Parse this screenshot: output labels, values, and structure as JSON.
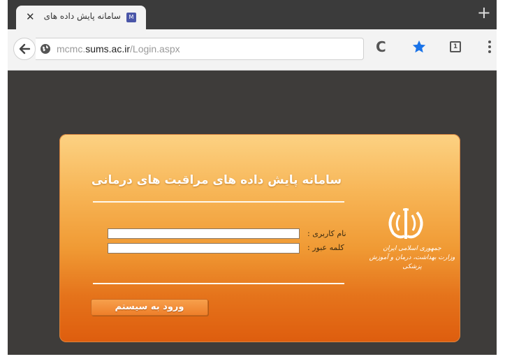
{
  "browser": {
    "tab_title": "سامانه پایش داده های",
    "favicon_text": "M",
    "new_tab_label": "+",
    "url_prefix": "mcmc.",
    "url_domain": "sums.ac.ir",
    "url_path": "/Login.aspx",
    "tabs_count": "1"
  },
  "login": {
    "title": "سامانه پایش داده های مراقبت های درمانی",
    "username_label": "نام کاربری :",
    "password_label": "کلمه عبور :",
    "username_value": "",
    "password_value": "",
    "submit_label": "ورود به سیستم",
    "emblem_line1": "جمهوری اسلامی ایران",
    "emblem_line2": "وزارت بهداشت، درمان و آموزش پزشکی"
  },
  "colors": {
    "panel_top": "#fcd283",
    "panel_bottom": "#de5d0e",
    "page_bg": "#3e3c3a",
    "star": "#1a73e8"
  }
}
